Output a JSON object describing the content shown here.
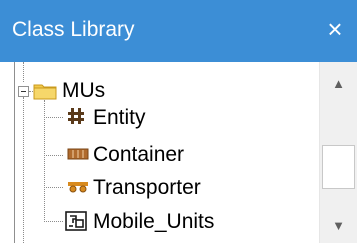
{
  "window": {
    "title": "Class Library",
    "close_glyph": "×"
  },
  "tree": {
    "root": {
      "label": "MUs",
      "icon": "folder-icon",
      "expanded": true
    },
    "children": [
      {
        "label": "Entity",
        "icon": "entity-icon"
      },
      {
        "label": "Container",
        "icon": "container-icon"
      },
      {
        "label": "Transporter",
        "icon": "transporter-icon"
      },
      {
        "label": "Mobile_Units",
        "icon": "mobile-units-icon"
      }
    ]
  },
  "scrollbar": {
    "up_glyph": "▲",
    "down_glyph": "▼"
  },
  "colors": {
    "titlebar": "#3c8ed6",
    "folder": "#f2c94c",
    "entity_icon": "#5a3a1a",
    "container_icon": "#b06b2e",
    "transporter_icon": "#d88a1e"
  }
}
